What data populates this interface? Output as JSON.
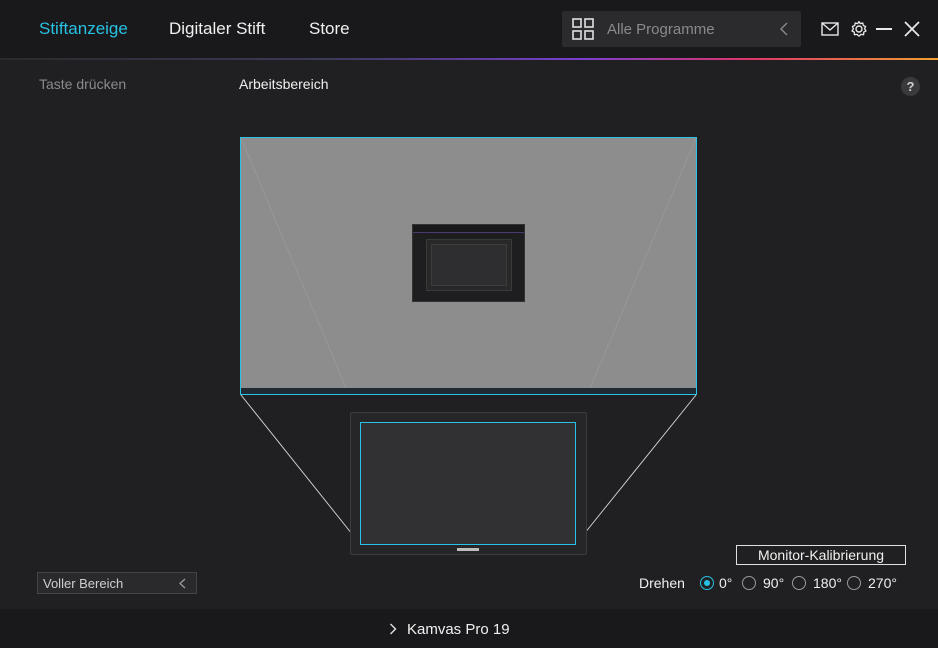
{
  "header": {
    "tabs": [
      {
        "label": "Stiftanzeige",
        "active": true
      },
      {
        "label": "Digitaler Stift",
        "active": false
      },
      {
        "label": "Store",
        "active": false
      }
    ],
    "search": {
      "value": "Alle Programme"
    },
    "icons": [
      "mail-icon",
      "gear-icon",
      "minimize-icon",
      "close-icon"
    ]
  },
  "subheader": {
    "left_label": "Taste drücken",
    "center_label": "Arbeitsbereich",
    "help": "?"
  },
  "workarea": {
    "calibration_button": "Monitor-Kalibrierung",
    "range_select": "Voller Bereich",
    "rotate_label": "Drehen",
    "rotation_options": [
      "0°",
      "90°",
      "180°",
      "270°"
    ],
    "rotation_selected": "0°"
  },
  "footer": {
    "device": "Kamvas Pro 19"
  },
  "colors": {
    "accent": "#27c1e3",
    "background": "#202022",
    "header": "#19191b"
  }
}
